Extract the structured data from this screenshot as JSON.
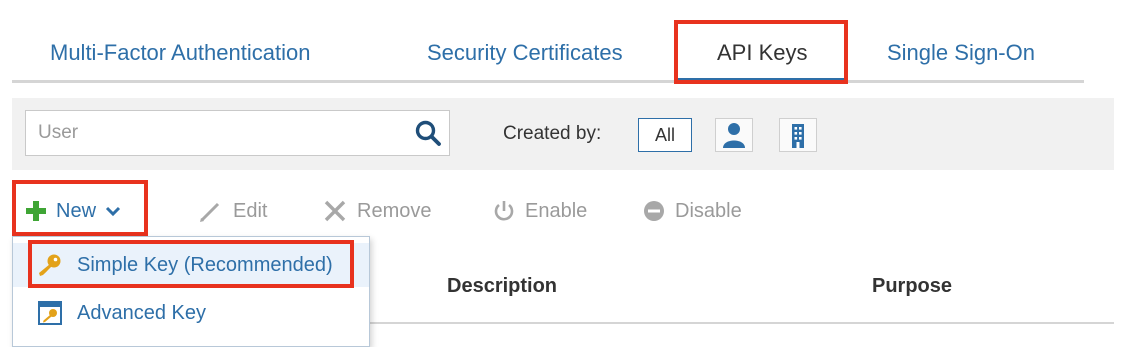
{
  "tabs": [
    {
      "label": "Multi-Factor Authentication",
      "active": false
    },
    {
      "label": "Security Certificates",
      "active": false
    },
    {
      "label": "API Keys",
      "active": true
    },
    {
      "label": "Single Sign-On",
      "active": false
    }
  ],
  "filter": {
    "search_placeholder": "User",
    "search_icon": "search-icon",
    "created_by_label": "Created by:",
    "all_label": "All",
    "user_icon": "user-icon",
    "organization_icon": "building-icon"
  },
  "toolbar": {
    "new_label": "New",
    "edit_label": "Edit",
    "remove_label": "Remove",
    "enable_label": "Enable",
    "disable_label": "Disable"
  },
  "new_menu": {
    "items": [
      {
        "label": "Simple Key (Recommended)",
        "icon": "key-icon"
      },
      {
        "label": "Advanced Key",
        "icon": "advanced-key-icon"
      }
    ]
  },
  "table": {
    "columns": [
      "Description",
      "Purpose"
    ]
  },
  "colors": {
    "accent": "#2e6fa8",
    "highlight": "#e8321e",
    "new_plus": "#3fa535",
    "disabled_text": "#9a9a9a"
  }
}
